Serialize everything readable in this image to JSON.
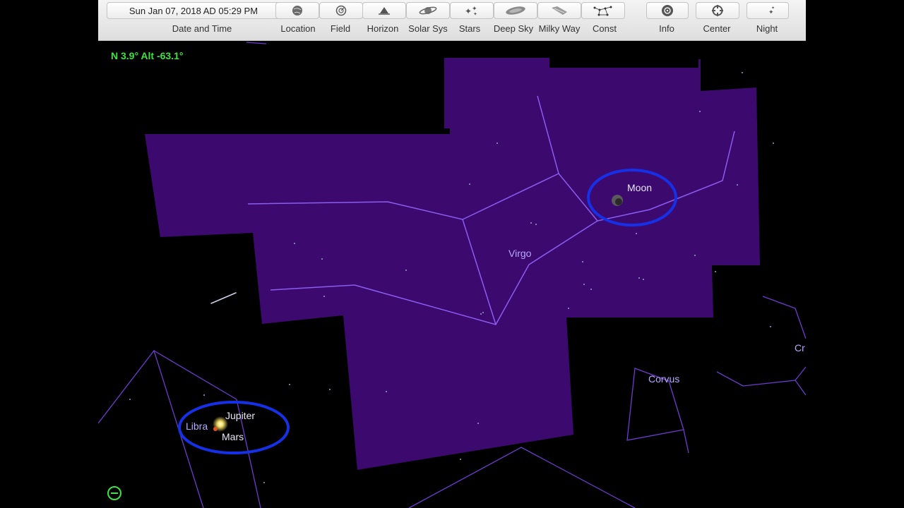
{
  "toolbar": {
    "datetime_value": "Sun Jan 07, 2018 AD 05:29 PM",
    "datetime_label": "Date and Time",
    "buttons": [
      {
        "label": "Location",
        "icon": "globe-icon"
      },
      {
        "label": "Field",
        "icon": "field-icon"
      },
      {
        "label": "Horizon",
        "icon": "horizon-icon"
      },
      {
        "label": "Solar Sys",
        "icon": "saturn-icon"
      },
      {
        "label": "Stars",
        "icon": "stars-icon"
      },
      {
        "label": "Deep Sky",
        "icon": "galaxy-icon"
      },
      {
        "label": "Milky Way",
        "icon": "milky-way-icon"
      },
      {
        "label": "Const",
        "icon": "constellation-icon"
      },
      {
        "label": "Info",
        "icon": "info-icon"
      },
      {
        "label": "Center",
        "icon": "center-icon"
      },
      {
        "label": "Night",
        "icon": "moon-stars-icon"
      }
    ]
  },
  "readout": {
    "alt_az": "N 3.9° Alt -63.1°"
  },
  "sky": {
    "constellations": [
      "Virgo",
      "Corvus",
      "Libra",
      "Cr"
    ],
    "objects": [
      "Moon",
      "Jupiter",
      "Mars"
    ]
  },
  "colors": {
    "constellation_fill": "#3c0a6e",
    "constellation_line": "#8a5cf0",
    "highlight_ring": "#1530e6",
    "readout_text": "#3fe23f"
  }
}
